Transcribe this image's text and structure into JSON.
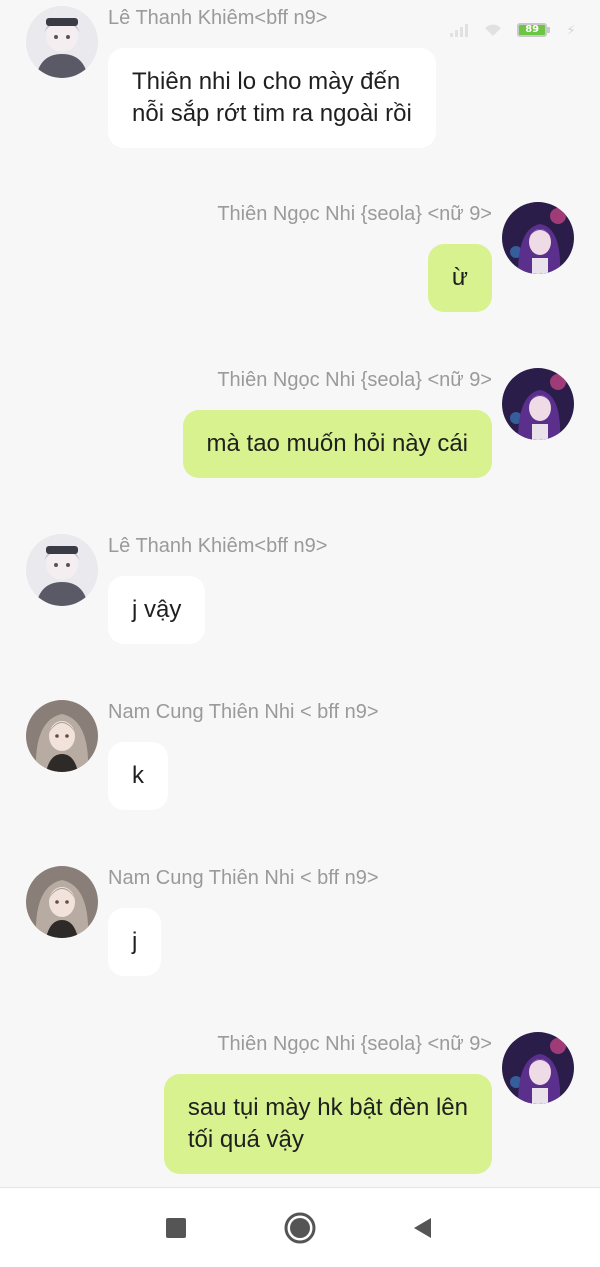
{
  "status_bar": {
    "battery_level": "89",
    "signal_icon": "signal-icon",
    "wifi_icon": "wifi-icon",
    "charging_icon": "charging-bolt-icon"
  },
  "messages": [
    {
      "side": "left",
      "sender": "Lê Thanh Khiêm<bff n9>",
      "avatar": "avatar-khiem",
      "lines": [
        "Thiên nhi lo cho mày đến",
        "nỗi sắp rớt tim ra ngoài rồi"
      ]
    },
    {
      "side": "right",
      "sender": "Thiên Ngọc Nhi {seola} <nữ 9>",
      "avatar": "avatar-ngoc-nhi",
      "lines": [
        "ừ"
      ]
    },
    {
      "side": "right",
      "sender": "Thiên Ngọc Nhi {seola} <nữ 9>",
      "avatar": "avatar-ngoc-nhi",
      "lines": [
        "mà tao muốn hỏi này cái"
      ]
    },
    {
      "side": "left",
      "sender": "Lê Thanh Khiêm<bff n9>",
      "avatar": "avatar-khiem",
      "lines": [
        "j vậy"
      ]
    },
    {
      "side": "left",
      "sender": "Nam Cung Thiên Nhi < bff n9>",
      "avatar": "avatar-nam-cung",
      "lines": [
        "k"
      ]
    },
    {
      "side": "left",
      "sender": "Nam Cung Thiên Nhi < bff n9>",
      "avatar": "avatar-nam-cung",
      "lines": [
        "j"
      ]
    },
    {
      "side": "right",
      "sender": "Thiên Ngọc Nhi {seola} <nữ 9>",
      "avatar": "avatar-ngoc-nhi",
      "lines": [
        "sau tụi mày hk bật đèn lên",
        "tối quá vậy"
      ]
    }
  ],
  "nav_bar": {
    "recent_icon": "recent-apps-square-icon",
    "home_icon": "home-circle-icon",
    "back_icon": "back-triangle-icon"
  },
  "colors": {
    "background": "#f7f7f7",
    "incoming_bubble": "#ffffff",
    "outgoing_bubble": "#d7f28e",
    "sender_name": "#9a9a9a",
    "text": "#1f1f1f",
    "battery": "#6cc644"
  }
}
